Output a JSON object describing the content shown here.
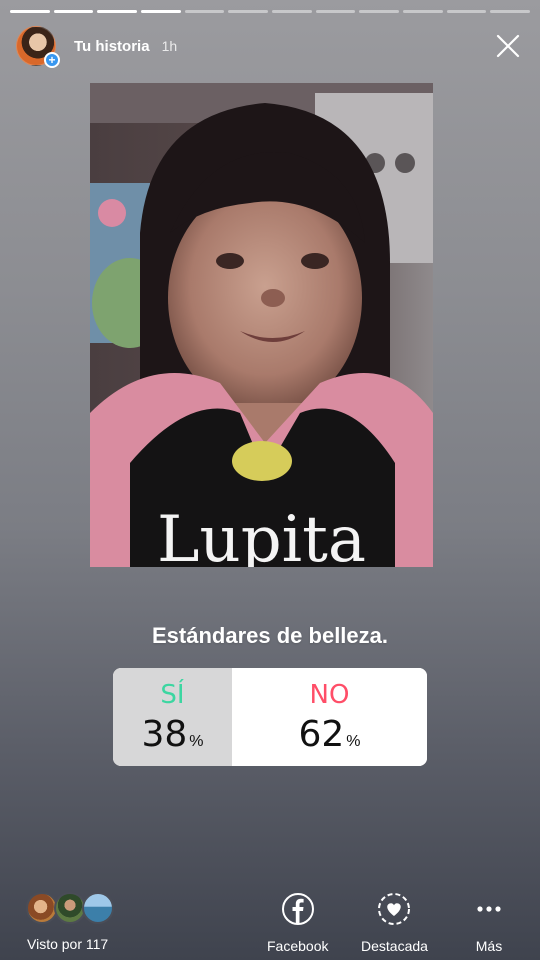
{
  "story": {
    "progress_total": 12,
    "progress_done": 4
  },
  "header": {
    "name": "Tu historia",
    "time": "1h",
    "close_icon": "close-icon",
    "avatar_badge": "+"
  },
  "photo": {
    "shirt_text": "Lupita"
  },
  "poll": {
    "question": "Estándares de belleza.",
    "options": [
      {
        "label": "SÍ",
        "percent": "38",
        "sign": "%",
        "color": "#3cd6a1"
      },
      {
        "label": "NO",
        "percent": "62",
        "sign": "%",
        "color": "#ff4e68"
      }
    ]
  },
  "footer": {
    "viewers_label": "Visto por 117",
    "actions": [
      {
        "label": "Facebook",
        "icon": "facebook-icon"
      },
      {
        "label": "Destacada",
        "icon": "highlight-heart-icon"
      },
      {
        "label": "Más",
        "icon": "more-dots-icon"
      }
    ]
  }
}
